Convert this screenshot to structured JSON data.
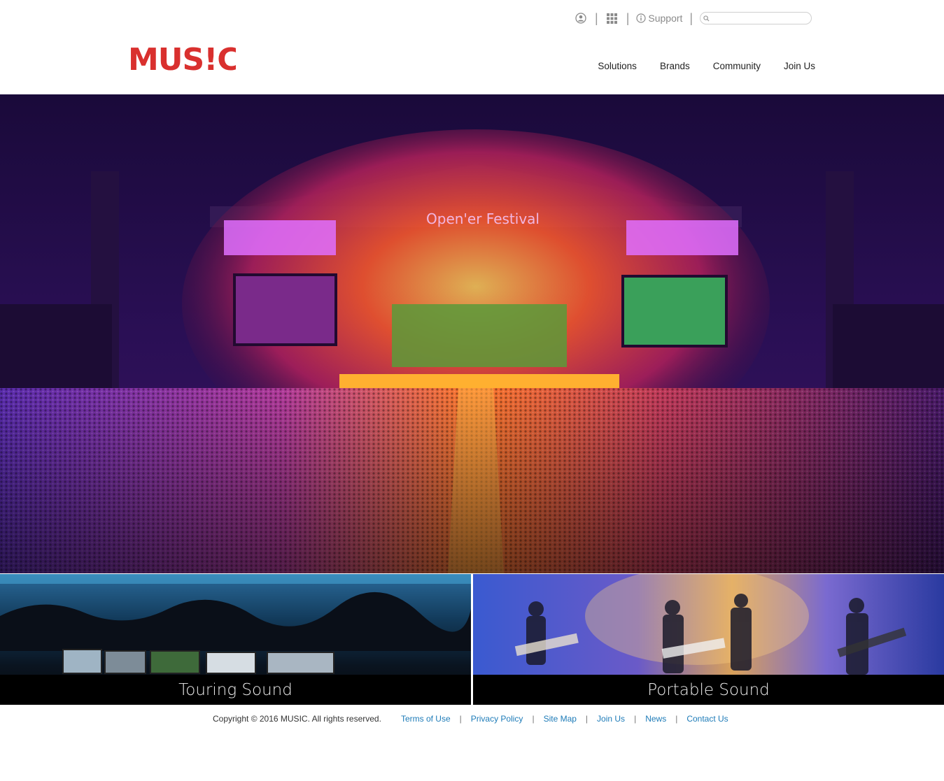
{
  "header": {
    "logo_text": "MUS!C",
    "utility": {
      "account_icon": "user-circle-icon",
      "apps_icon": "grid-icon",
      "support_icon": "info-icon",
      "support_label": "Support",
      "search_placeholder": "",
      "search_icon": "search-icon"
    },
    "nav": [
      "Solutions",
      "Brands",
      "Community",
      "Join Us"
    ]
  },
  "hero": {
    "stage_sign": "Open'er Festival"
  },
  "tiles": [
    {
      "label": "Touring Sound"
    },
    {
      "label": "Portable Sound"
    }
  ],
  "footer": {
    "copyright": "Copyright © 2016 MUSIC. All rights reserved.",
    "links": [
      "Terms of Use",
      "Privacy Policy",
      "Site Map",
      "Join Us",
      "News",
      "Contact Us"
    ]
  },
  "colors": {
    "brand_red": "#d9302e",
    "link_blue": "#1d7bb8",
    "caption_bg": "#000000"
  }
}
